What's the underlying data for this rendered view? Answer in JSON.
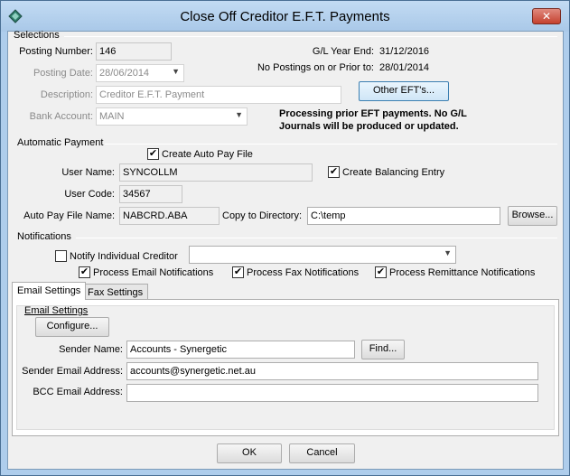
{
  "window": {
    "title": "Close Off Creditor E.F.T. Payments",
    "close_label": "✕"
  },
  "selections": {
    "section_title": "Selections",
    "posting_number_label": "Posting Number:",
    "posting_number_value": "146",
    "posting_date_label": "Posting Date:",
    "posting_date_value": "28/06/2014",
    "description_label": "Description:",
    "description_value": "Creditor E.F.T. Payment",
    "bank_account_label": "Bank Account:",
    "bank_account_value": "MAIN",
    "gl_year_end_label": "G/L Year End:",
    "gl_year_end_value": "31/12/2016",
    "no_postings_label": "No Postings on or Prior to:",
    "no_postings_value": "28/01/2014",
    "other_efts_button": "Other EFT's...",
    "note_line1": "Processing prior EFT payments.  No G/L",
    "note_line2": "Journals will be produced or updated."
  },
  "automatic_payment": {
    "section_title": "Automatic Payment",
    "create_auto_pay_file_label": "Create Auto Pay File",
    "create_auto_pay_file_checked": true,
    "user_name_label": "User Name:",
    "user_name_value": "SYNCOLLM",
    "create_balancing_entry_label": "Create Balancing Entry",
    "create_balancing_entry_checked": true,
    "user_code_label": "User Code:",
    "user_code_value": "34567",
    "auto_pay_file_name_label": "Auto Pay File Name:",
    "auto_pay_file_name_value": "NABCRD.ABA",
    "copy_to_directory_label": "Copy to Directory:",
    "copy_to_directory_value": "C:\\temp",
    "browse_button": "Browse..."
  },
  "notifications": {
    "section_title": "Notifications",
    "notify_individual_creditor_label": "Notify Individual Creditor",
    "notify_individual_creditor_checked": false,
    "notify_creditor_value": "",
    "process_email_label": "Process Email Notifications",
    "process_email_checked": true,
    "process_fax_label": "Process Fax Notifications",
    "process_fax_checked": true,
    "process_remittance_label": "Process Remittance Notifications",
    "process_remittance_checked": true
  },
  "tabs": [
    {
      "label": "Email Settings",
      "active": true
    },
    {
      "label": "Fax Settings",
      "active": false
    }
  ],
  "email_settings": {
    "group_title": "Email Settings",
    "configure_button": "Configure...",
    "sender_name_label": "Sender Name:",
    "sender_name_value": "Accounts - Synergetic",
    "find_button": "Find...",
    "sender_email_label": "Sender Email Address:",
    "sender_email_value": "accounts@synergetic.net.au",
    "bcc_email_label": "BCC Email Address:",
    "bcc_email_value": ""
  },
  "footer": {
    "ok_button": "OK",
    "cancel_button": "Cancel"
  },
  "icons": {
    "app_icon": "diamond-app-icon",
    "checkmark": "✔",
    "dropdown": "▼"
  }
}
